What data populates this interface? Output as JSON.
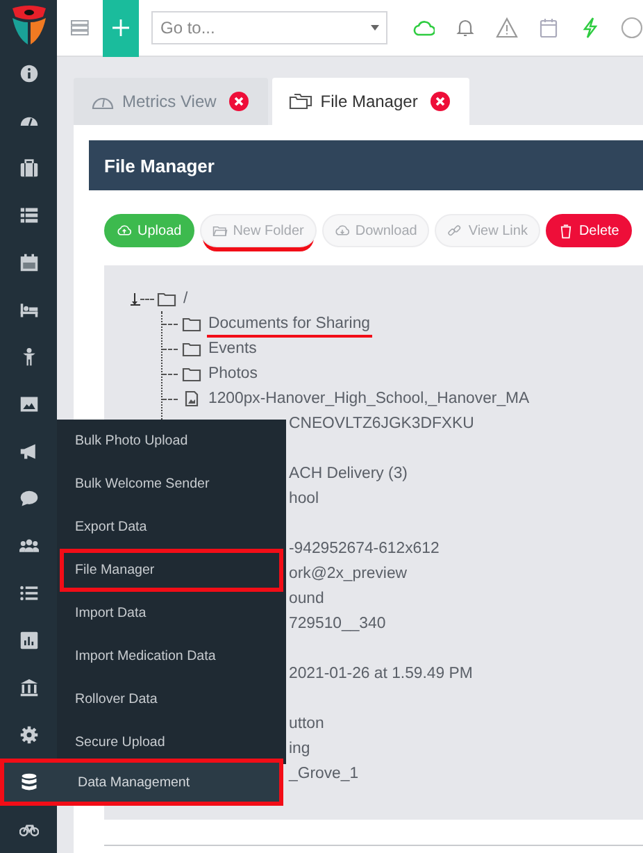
{
  "sidebar": {
    "items": [
      {
        "selected": false
      },
      {
        "selected": false
      },
      {
        "selected": false
      },
      {
        "selected": false
      },
      {
        "selected": false
      },
      {
        "selected": false
      },
      {
        "selected": false
      },
      {
        "selected": false
      },
      {
        "selected": false
      },
      {
        "selected": false
      },
      {
        "selected": false
      },
      {
        "selected": false
      },
      {
        "selected": false
      },
      {
        "selected": false
      },
      {
        "selected": false
      },
      {
        "selected": true,
        "label": "Data Management",
        "annotated": true
      },
      {
        "selected": false
      }
    ]
  },
  "flyout": {
    "items": [
      {
        "label": "Bulk Photo Upload",
        "annotated": false
      },
      {
        "label": "Bulk Welcome Sender",
        "annotated": false
      },
      {
        "label": "Export Data",
        "annotated": false
      },
      {
        "label": "File Manager",
        "annotated": true
      },
      {
        "label": "Import Data",
        "annotated": false
      },
      {
        "label": "Import Medication Data",
        "annotated": false
      },
      {
        "label": "Rollover Data",
        "annotated": false
      },
      {
        "label": "Secure Upload",
        "annotated": false
      }
    ]
  },
  "topbar": {
    "search": {
      "placeholder": "Go to..."
    }
  },
  "tabs": [
    {
      "label": "Metrics View",
      "selected": false
    },
    {
      "label": "File Manager",
      "selected": true
    }
  ],
  "panel": {
    "title": "File Manager",
    "buttons": [
      {
        "label": "Upload",
        "kind": "success",
        "annotated": false
      },
      {
        "label": "New Folder",
        "kind": "default",
        "annotated": true
      },
      {
        "label": "Download",
        "kind": "default",
        "annotated": false
      },
      {
        "label": "View Link",
        "kind": "default",
        "annotated": false
      },
      {
        "label": "Delete",
        "kind": "danger",
        "annotated": false
      }
    ],
    "tree": {
      "label": "/",
      "expanded": true,
      "children": [
        {
          "kind": "folder",
          "label": "Documents for Sharing",
          "annotated": true
        },
        {
          "kind": "folder",
          "label": "Events",
          "annotated": false
        },
        {
          "kind": "folder",
          "label": "Photos",
          "annotated": false
        },
        {
          "kind": "file",
          "label": "1200px-Hanover_High_School,_Hanover_MA",
          "annotated": false
        },
        {
          "kind": "fragment",
          "label": "CNEOVLTZ6JGK3DFXKU",
          "annotated": false
        },
        {
          "kind": "covered"
        },
        {
          "kind": "fragment",
          "label": "ACH Delivery (3)",
          "annotated": false
        },
        {
          "kind": "fragment",
          "label": "hool",
          "annotated": false
        },
        {
          "kind": "covered"
        },
        {
          "kind": "fragment",
          "label": "-942952674-612x612",
          "annotated": false
        },
        {
          "kind": "fragment",
          "label": "ork@2x_preview",
          "annotated": false
        },
        {
          "kind": "fragment",
          "label": "ound",
          "annotated": false
        },
        {
          "kind": "fragment",
          "label": "729510__340",
          "annotated": false
        },
        {
          "kind": "covered"
        },
        {
          "kind": "fragment",
          "label": "2021-01-26 at 1.59.49 PM",
          "annotated": false
        },
        {
          "kind": "covered"
        },
        {
          "kind": "fragment",
          "label": "utton",
          "annotated": false
        },
        {
          "kind": "fragment",
          "label": "ing",
          "annotated": false
        },
        {
          "kind": "fragment",
          "label": "_Grove_1",
          "annotated": false
        }
      ]
    }
  }
}
